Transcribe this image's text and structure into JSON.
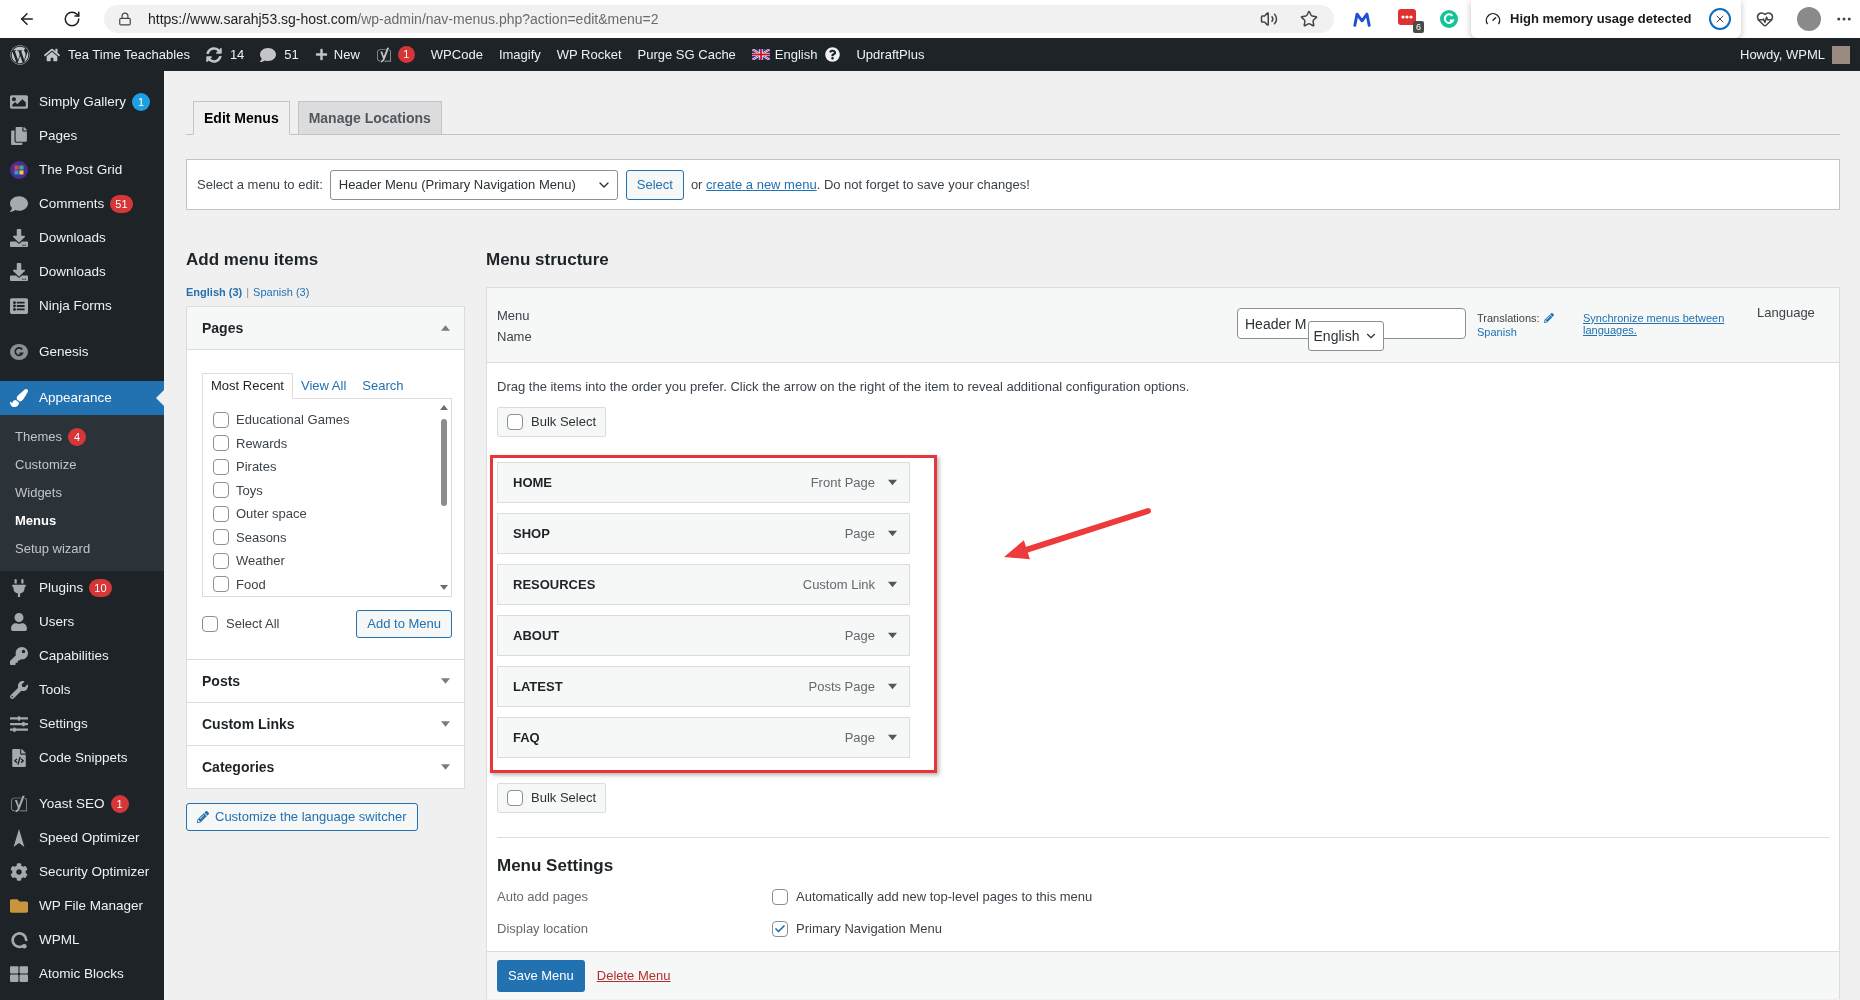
{
  "browser": {
    "url_host": "https://www.sarahj53.sg-host.com",
    "url_path": "/wp-admin/nav-menus.php?action=edit&menu=2",
    "extension_badge": "6",
    "alert": "High memory usage detected"
  },
  "admin_bar": {
    "items": [
      {
        "kind": "logo"
      },
      {
        "kind": "site",
        "label": "Tea Time Teachables"
      },
      {
        "kind": "updates",
        "label": "14"
      },
      {
        "kind": "comments",
        "label": "51"
      },
      {
        "kind": "new",
        "label": "New"
      },
      {
        "kind": "seo",
        "badge": "1"
      },
      {
        "kind": "link",
        "label": "WPCode"
      },
      {
        "kind": "link",
        "label": "Imagify"
      },
      {
        "kind": "link",
        "label": "WP Rocket"
      },
      {
        "kind": "link",
        "label": "Purge SG Cache"
      },
      {
        "kind": "language",
        "label": "English"
      },
      {
        "kind": "link",
        "label": "UpdraftPlus"
      }
    ],
    "greeting": "Howdy, WPML"
  },
  "sidebar": {
    "groups": [
      [
        {
          "kind": "gallery",
          "label": "Simply Gallery",
          "badge": {
            "text": "1",
            "color": "#1e9fe3"
          },
          "selected": false
        },
        {
          "kind": "pages",
          "label": "Pages",
          "selected": false
        },
        {
          "kind": "grid",
          "label": "The Post Grid",
          "selected": false
        },
        {
          "kind": "comments",
          "label": "Comments",
          "badge": {
            "text": "51",
            "color": "#d63638"
          },
          "selected": false
        },
        {
          "kind": "download",
          "label": "Downloads",
          "selected": false
        },
        {
          "kind": "download",
          "label": "Downloads",
          "selected": false
        },
        {
          "kind": "forms",
          "label": "Ninja Forms",
          "selected": false
        }
      ],
      [
        {
          "kind": "genesis",
          "label": "Genesis",
          "selected": false
        }
      ],
      [
        {
          "kind": "appearance",
          "label": "Appearance",
          "selected": true,
          "children": [
            {
              "label": "Themes",
              "badge": {
                "text": "4",
                "color": "#d63638"
              },
              "selected": false
            },
            {
              "label": "Customize",
              "selected": false
            },
            {
              "label": "Widgets",
              "selected": false
            },
            {
              "label": "Menus",
              "selected": true
            },
            {
              "label": "Setup wizard",
              "selected": false
            }
          ]
        },
        {
          "kind": "plugins",
          "label": "Plugins",
          "badge": {
            "text": "10",
            "color": "#d63638"
          },
          "selected": false
        },
        {
          "kind": "users",
          "label": "Users",
          "selected": false
        },
        {
          "kind": "key",
          "label": "Capabilities",
          "selected": false
        },
        {
          "kind": "tools",
          "label": "Tools",
          "selected": false
        },
        {
          "kind": "settings",
          "label": "Settings",
          "selected": false
        },
        {
          "kind": "code",
          "label": "Code Snippets",
          "selected": false
        }
      ],
      [
        {
          "kind": "seo",
          "label": "Yoast SEO",
          "badge": {
            "text": "1",
            "color": "#d63638"
          },
          "selected": false
        },
        {
          "kind": "speed",
          "label": "Speed Optimizer",
          "selected": false
        },
        {
          "kind": "security",
          "label": "Security Optimizer",
          "selected": false
        },
        {
          "kind": "files",
          "label": "WP File Manager",
          "selected": false
        },
        {
          "kind": "translate",
          "label": "WPML",
          "selected": false
        },
        {
          "kind": "blocks",
          "label": "Atomic Blocks",
          "selected": false
        }
      ]
    ]
  },
  "tabs": [
    {
      "label": "Edit Menus",
      "selected": true
    },
    {
      "label": "Manage Locations",
      "selected": false
    }
  ],
  "menu_picker": {
    "label": "Select a menu to edit:",
    "value": "Header Menu (Primary Navigation Menu)",
    "button": "Select",
    "hint_start": "or",
    "hint_link": "create a new menu",
    "hint_end": ". Do not forget to save your changes!"
  },
  "add_menu_items": {
    "title": "Add menu items",
    "languages": [
      {
        "label": "English (3)",
        "selected": true
      },
      {
        "label": "Spanish (3)",
        "selected": false
      }
    ],
    "language_separator": "|",
    "panels": [
      {
        "title": "Pages",
        "expanded": true,
        "tabs": [
          {
            "label": "Most Recent",
            "selected": true
          },
          {
            "label": "View All",
            "selected": false
          },
          {
            "label": "Search",
            "selected": false
          }
        ],
        "items": [
          {
            "label": "Educational Games",
            "checked": false
          },
          {
            "label": "Rewards",
            "checked": false
          },
          {
            "label": "Pirates",
            "checked": false
          },
          {
            "label": "Toys",
            "checked": false
          },
          {
            "label": "Outer space",
            "checked": false
          },
          {
            "label": "Seasons",
            "checked": false
          },
          {
            "label": "Weather",
            "checked": false
          },
          {
            "label": "Food",
            "checked": false
          }
        ],
        "select_all": {
          "label": "Select All",
          "checked": false
        },
        "button": "Add to Menu"
      },
      {
        "title": "Posts",
        "expanded": false
      },
      {
        "title": "Custom Links",
        "expanded": false
      },
      {
        "title": "Categories",
        "expanded": false
      }
    ],
    "switcher_button": "Customize the language switcher"
  },
  "menu_structure": {
    "title": "Menu structure",
    "name_label": "Menu Name",
    "name_value": "Header M",
    "language_select": "English",
    "translations_label": "Translations:",
    "translation_link": "Spanish",
    "sync_link": "Synchronize menus between languages.",
    "language_label": "Language",
    "instructions": "Drag the items into the order you prefer. Click the arrow on the right of the item to reveal additional configuration options.",
    "bulk_select_top": {
      "label": "Bulk Select",
      "checked": false
    },
    "items": [
      {
        "title": "HOME",
        "type": "Front Page"
      },
      {
        "title": "SHOP",
        "type": "Page"
      },
      {
        "title": "RESOURCES",
        "type": "Custom Link"
      },
      {
        "title": "ABOUT",
        "type": "Page"
      },
      {
        "title": "LATEST",
        "type": "Posts Page"
      },
      {
        "title": "FAQ",
        "type": "Page"
      }
    ],
    "bulk_select_bottom": {
      "label": "Bulk Select",
      "checked": false
    },
    "settings": {
      "title": "Menu Settings",
      "rows": [
        {
          "label": "Auto add pages",
          "option": "Automatically add new top-level pages to this menu",
          "checked": false
        },
        {
          "label": "Display location",
          "option": "Primary Navigation Menu",
          "checked": true
        }
      ]
    },
    "save_button": "Save Menu",
    "delete_link": "Delete Menu"
  }
}
